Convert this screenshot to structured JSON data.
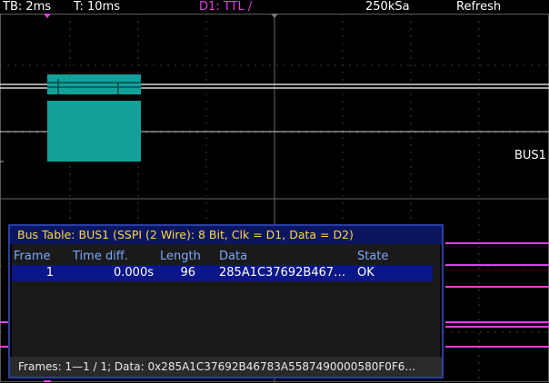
{
  "status": {
    "timebase": "TB: 2ms",
    "timeoffset": "T: 10ms",
    "trigger": "D1: TTL /",
    "samplerate": "250kSa",
    "mode": "Refresh"
  },
  "bus_label": "BUS1",
  "bus_table": {
    "title": "Bus Table: BUS1 (SSPI (2 Wire): 8 Bit, Clk = D1, Data = D2)",
    "columns": [
      "Frame",
      "Time diff.",
      "Length",
      "Data",
      "State"
    ],
    "rows": [
      {
        "frame": "1",
        "time_diff": "0.000s",
        "length": "96",
        "data": "285A1C37692B467…",
        "state": "OK"
      }
    ],
    "footer": "Frames:  1—1 / 1; Data: 0x285A1C37692B46783A5587490000580F0F6…"
  },
  "colors": {
    "trigger_magenta": "#e040e0",
    "bus_teal": "#14a09a",
    "table_header_text": "#7aa7ff",
    "table_title_text": "#ffd740",
    "selected_row": "#0b1687"
  }
}
